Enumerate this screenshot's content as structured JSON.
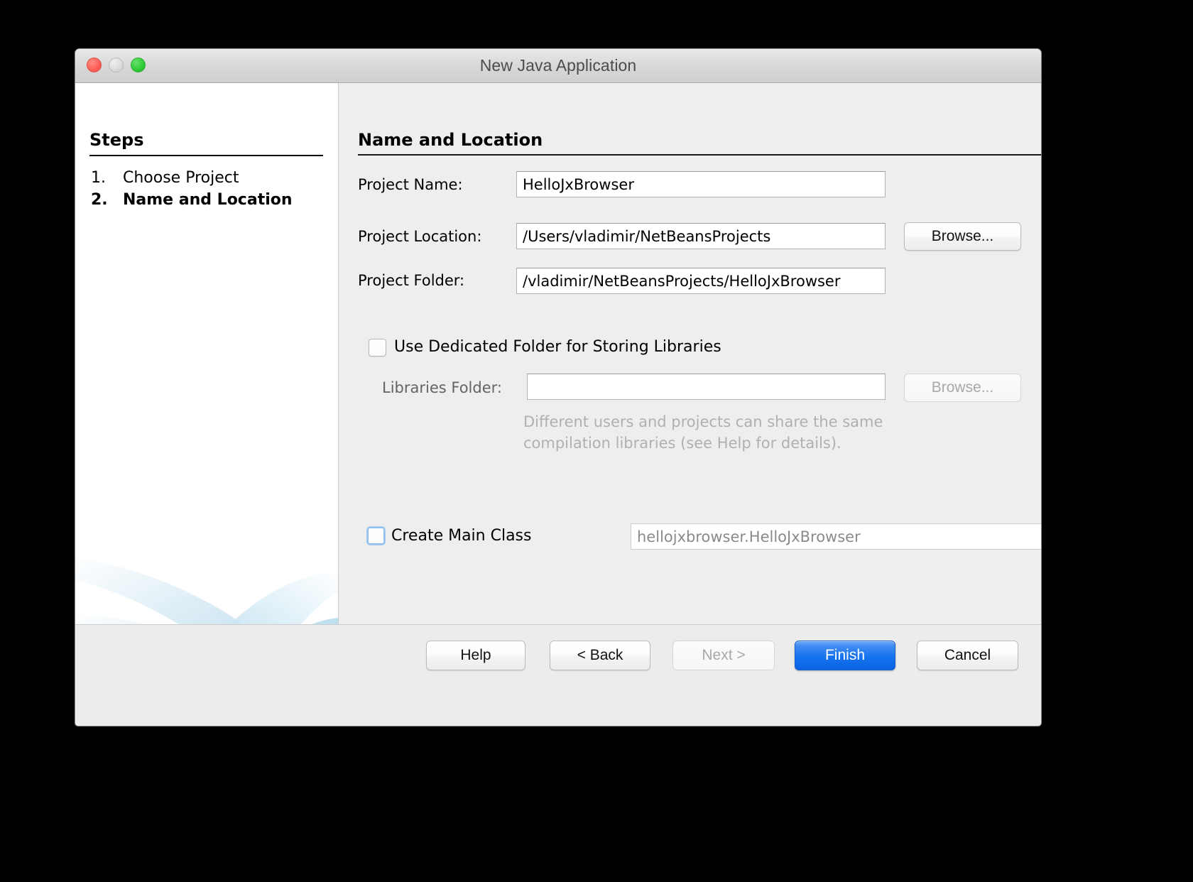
{
  "window": {
    "title": "New Java Application"
  },
  "steps": {
    "heading": "Steps",
    "items": [
      {
        "number": "1.",
        "label": "Choose Project"
      },
      {
        "number": "2.",
        "label": "Name and Location"
      }
    ]
  },
  "form": {
    "section_title": "Name and Location",
    "project_name": {
      "label": "Project Name:",
      "value": "HelloJxBrowser"
    },
    "project_location": {
      "label": "Project Location:",
      "value": "/Users/vladimir/NetBeansProjects",
      "browse_label": "Browse..."
    },
    "project_folder": {
      "label": "Project Folder:",
      "value": "/vladimir/NetBeansProjects/HelloJxBrowser"
    },
    "use_dedicated_folder": {
      "label": "Use Dedicated Folder for Storing Libraries",
      "checked": false
    },
    "libraries_folder": {
      "label": "Libraries Folder:",
      "value": "",
      "browse_label": "Browse...",
      "hint": "Different users and projects can share the same compilation libraries (see Help for details)."
    },
    "create_main_class": {
      "label": "Create Main Class",
      "value": "hellojxbrowser.HelloJxBrowser",
      "checked": false
    }
  },
  "footer": {
    "buttons": [
      {
        "label": "Help",
        "state": "enabled"
      },
      {
        "label": "< Back",
        "state": "enabled"
      },
      {
        "label": "Next >",
        "state": "disabled"
      },
      {
        "label": "Finish",
        "state": "default"
      },
      {
        "label": "Cancel",
        "state": "enabled"
      }
    ]
  },
  "colors": {
    "accent": "#1673ee",
    "window_background": "#eeeeee",
    "panel_background": "#ffffff",
    "hint_text": "#b0b0b0",
    "close_dot": "#ff6259",
    "minimize_dot": "#dcdcdc",
    "maximize_dot": "#33cc3a"
  }
}
